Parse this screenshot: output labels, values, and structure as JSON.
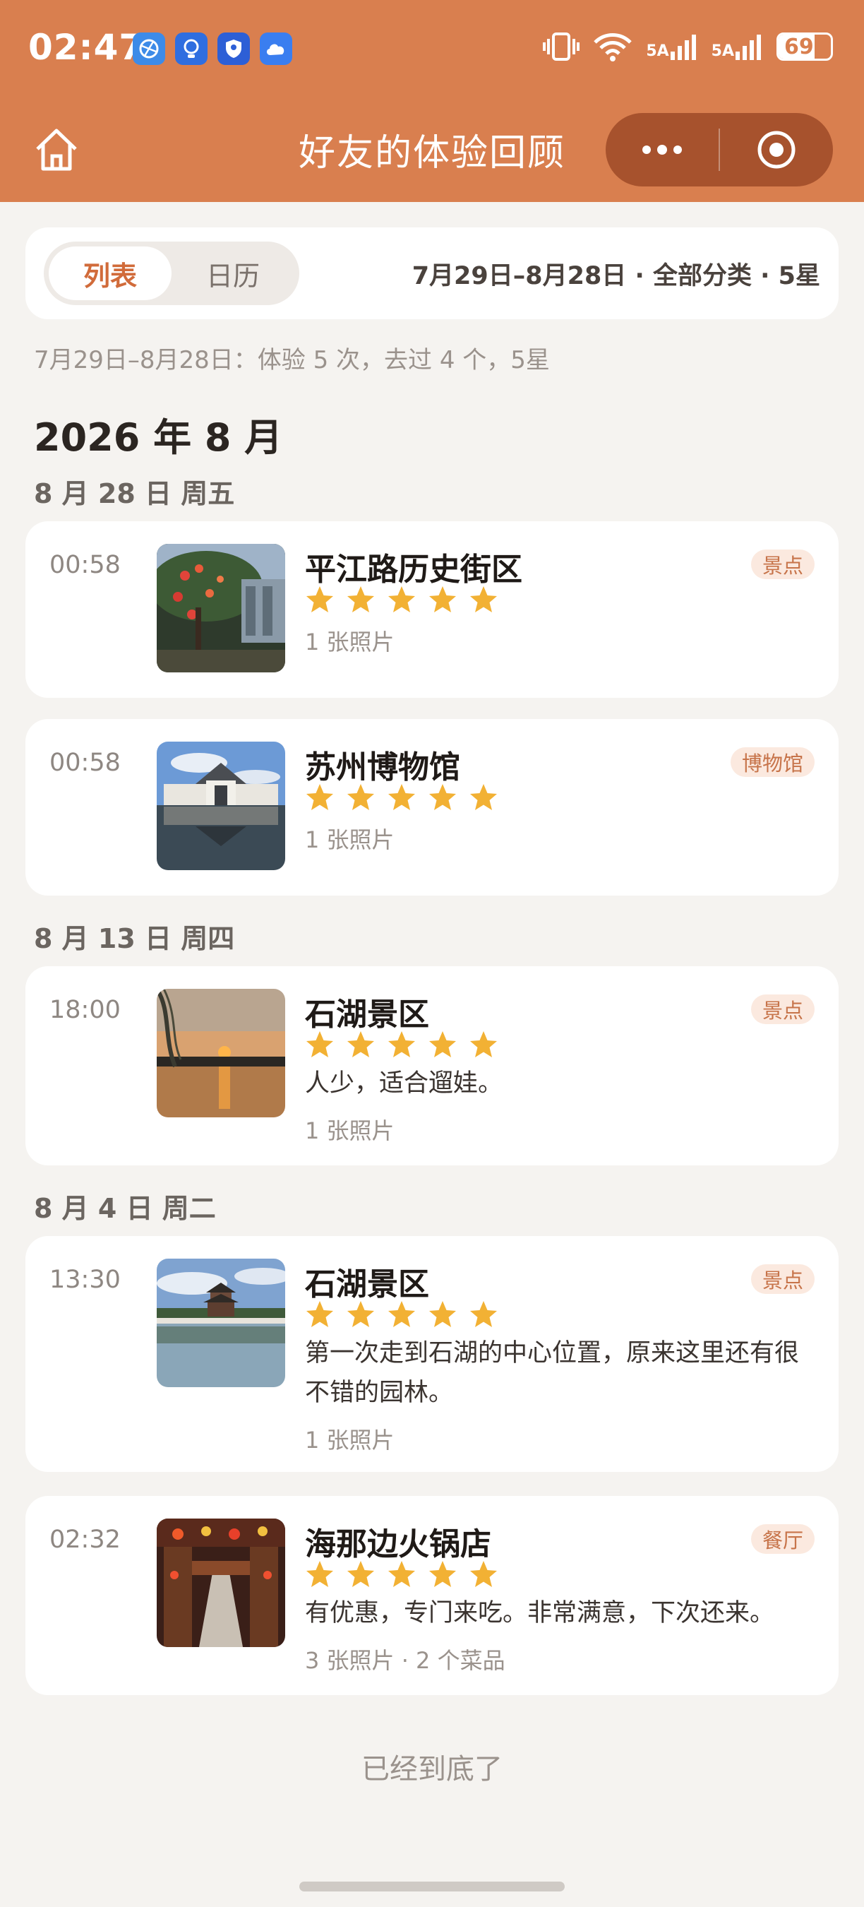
{
  "status_bar": {
    "time": "02:47",
    "signal_1": "5A",
    "signal_2": "5A",
    "battery": "69",
    "battery_level": 0.69,
    "app_icons": [
      "browser-icon",
      "lightbulb-icon",
      "shield-icon",
      "cloud-icon"
    ]
  },
  "nav": {
    "title": "好友的体验回顾",
    "more_icon": "more-dots-icon",
    "target_icon": "target-icon",
    "home_icon": "home-icon"
  },
  "filter": {
    "tabs": [
      {
        "label": "列表",
        "active": true
      },
      {
        "label": "日历",
        "active": false
      }
    ],
    "summary": "7月29日–8月28日 · 全部分类 · 5星"
  },
  "summary_line": "7月29日–8月28日：体验 5 次，去过 4 个，5星",
  "month_title": "2026 年 8 月",
  "days": [
    {
      "label": "8 月 28 日 周五"
    },
    {
      "label": "8 月 13 日 周四"
    },
    {
      "label": "8 月 4 日 周二"
    }
  ],
  "entries": [
    {
      "time": "00:58",
      "name": "平江路历史街区",
      "tag": "景点",
      "rating": 5,
      "comment": "",
      "meta": "1 张照片"
    },
    {
      "time": "00:58",
      "name": "苏州博物馆",
      "tag": "博物馆",
      "rating": 5,
      "comment": "",
      "meta": "1 张照片"
    },
    {
      "time": "18:00",
      "name": "石湖景区",
      "tag": "景点",
      "rating": 5,
      "comment": "人少，适合遛娃。",
      "meta": "1 张照片"
    },
    {
      "time": "13:30",
      "name": "石湖景区",
      "tag": "景点",
      "rating": 5,
      "comment": "第一次走到石湖的中心位置，原来这里还有很不错的园林。",
      "meta": "1 张照片"
    },
    {
      "time": "02:32",
      "name": "海那边火锅店",
      "tag": "餐厅",
      "rating": 5,
      "comment": "有优惠，专门来吃。非常满意，下次还来。",
      "meta": "3 张照片 · 2 个菜品"
    }
  ],
  "footer": {
    "end_text": "已经到底了"
  },
  "colors": {
    "header": "#d97f4f",
    "accent": "#d16b3a",
    "star": "#f2b134",
    "tag_bg": "#fbe9df",
    "tag_text": "#c7744a"
  }
}
